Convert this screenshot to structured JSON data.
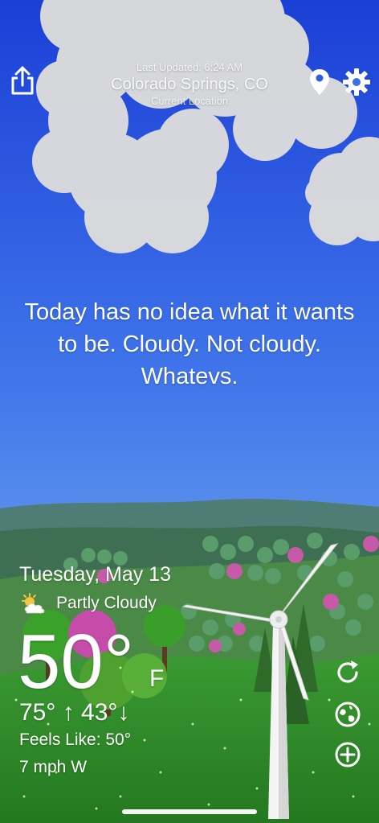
{
  "header": {
    "last_updated": "Last Updated: 6:24 AM",
    "city": "Colorado Springs, CO",
    "current_location": "Current Location"
  },
  "icons": {
    "share": "share-icon",
    "location": "location-pin-icon",
    "settings": "gear-icon",
    "condition": "partly-cloudy-icon",
    "refresh": "refresh-icon",
    "radar": "radar-globe-icon",
    "add": "add-circle-icon"
  },
  "phrase": "Today has no idea what it wants to be. Cloudy. Not cloudy. Whatevs.",
  "weather": {
    "date": "Tuesday, May 13",
    "condition": "Partly Cloudy",
    "temperature": "50°",
    "unit": "F",
    "hi_lo": "75° ↑  43°↓",
    "feels_like": "Feels Like: 50°",
    "wind": "7 mph W"
  },
  "colors": {
    "sky_top": "#1a3fd6",
    "sky_bottom": "#7ab8f2",
    "hills_far": "#4e7a74",
    "grass": "#2f8a2a",
    "cloud": "#d9d9d9"
  }
}
